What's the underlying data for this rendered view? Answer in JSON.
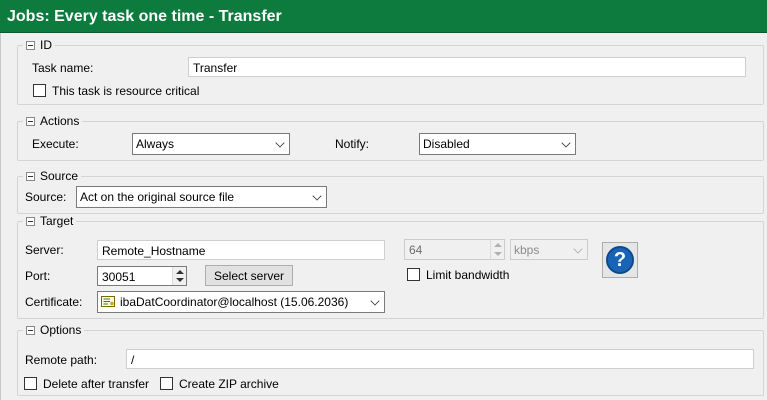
{
  "window": {
    "title": "Jobs: Every task one time - Transfer"
  },
  "id_group": {
    "legend": "ID",
    "task_name_label": "Task name:",
    "task_name_value": "Transfer",
    "resource_critical_label": "This task is resource critical"
  },
  "actions_group": {
    "legend": "Actions",
    "execute_label": "Execute:",
    "execute_value": "Always",
    "notify_label": "Notify:",
    "notify_value": "Disabled"
  },
  "source_group": {
    "legend": "Source",
    "source_label": "Source:",
    "source_value": "Act on the original source file"
  },
  "target_group": {
    "legend": "Target",
    "server_label": "Server:",
    "server_value": "Remote_Hostname",
    "port_label": "Port:",
    "port_value": "30051",
    "select_server_label": "Select server",
    "bandwidth_value": "64",
    "bandwidth_unit": "kbps",
    "limit_bandwidth_label": "Limit bandwidth",
    "certificate_label": "Certificate:",
    "certificate_value": "ibaDatCoordinator@localhost (15.06.2036)",
    "help_symbol": "?"
  },
  "options_group": {
    "legend": "Options",
    "remote_path_label": "Remote path:",
    "remote_path_value": "/",
    "delete_after_label": "Delete after transfer",
    "create_zip_label": "Create ZIP archive"
  },
  "colors": {
    "title_bar": "#0d7a3e",
    "help_icon": "#1a64b8"
  },
  "icons": {
    "collapse": "collapse-minus-icon",
    "certificate": "certificate-icon",
    "help": "help-icon"
  }
}
